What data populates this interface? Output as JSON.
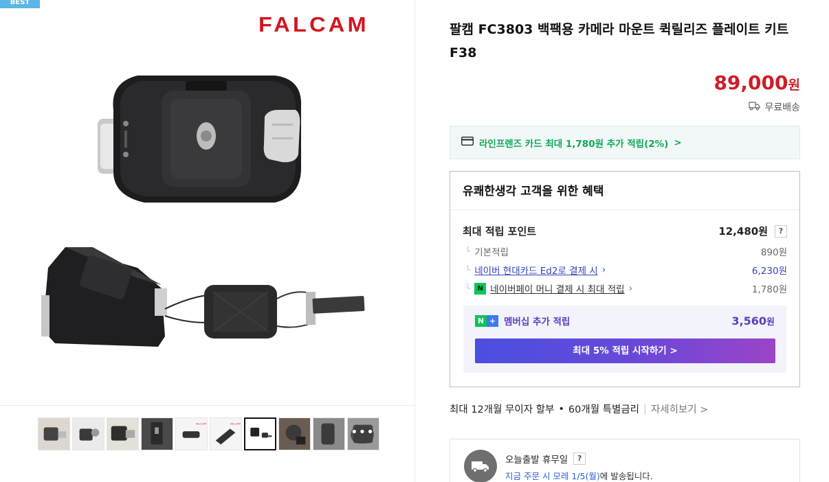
{
  "gallery": {
    "badge": "BEST",
    "brand": "FALCAM",
    "more_button": "•••",
    "thumbnails": [
      {
        "name": "thumb-1",
        "active": false
      },
      {
        "name": "thumb-2",
        "active": false
      },
      {
        "name": "thumb-3",
        "active": false
      },
      {
        "name": "thumb-4",
        "active": false
      },
      {
        "name": "thumb-5",
        "active": false
      },
      {
        "name": "thumb-6",
        "active": false
      },
      {
        "name": "thumb-7",
        "active": true
      },
      {
        "name": "thumb-8",
        "active": false
      },
      {
        "name": "thumb-9",
        "active": false
      },
      {
        "name": "thumb-10",
        "active": false
      }
    ]
  },
  "product": {
    "title": "팔캠 FC3803 백팩용 카메라 마운트 퀵릴리즈 플레이트 키트 F38",
    "price": "89,000",
    "price_unit": "원",
    "shipping": "무료배송"
  },
  "card_benefit": {
    "text": "라인프렌즈 카드 최대 1,780원 추가 적립(2%)",
    "arrow": ">"
  },
  "benefits": {
    "heading": "유쾌한생각 고객을 위한 혜택",
    "max_point_label": "최대 적립 포인트",
    "max_point_value": "12,480원",
    "help": "?",
    "rows": [
      {
        "label": "기본적립",
        "value": "890원"
      },
      {
        "label": "네이버 현대카드 Ed2로 결제 시",
        "value": "6,230원"
      },
      {
        "label": "네이버페이 머니 결제 시 최대 적립",
        "value": "1,780원"
      }
    ],
    "membership_label": "멤버십 추가 적립",
    "membership_value": "3,560",
    "membership_unit": "원",
    "cta": "최대 5% 적립 시작하기 >"
  },
  "installment": {
    "main": "최대 12개월 무이자 할부",
    "dot": "•",
    "special": "60개월 특별금리",
    "more": "자세히보기 >"
  },
  "delivery": {
    "title": "오늘출발 휴무일",
    "help": "?",
    "sub_highlight": "지금 주문 시 모레 1/5(월)",
    "sub_rest": "에 발송됩니다."
  },
  "colors": {
    "price_red": "#cc1e2a",
    "brand_red": "#d2151f",
    "card_green": "#10a85a",
    "link_blue": "#3344bb",
    "membership_purple": "#5a3fc0",
    "naver_green": "#03c75a"
  }
}
